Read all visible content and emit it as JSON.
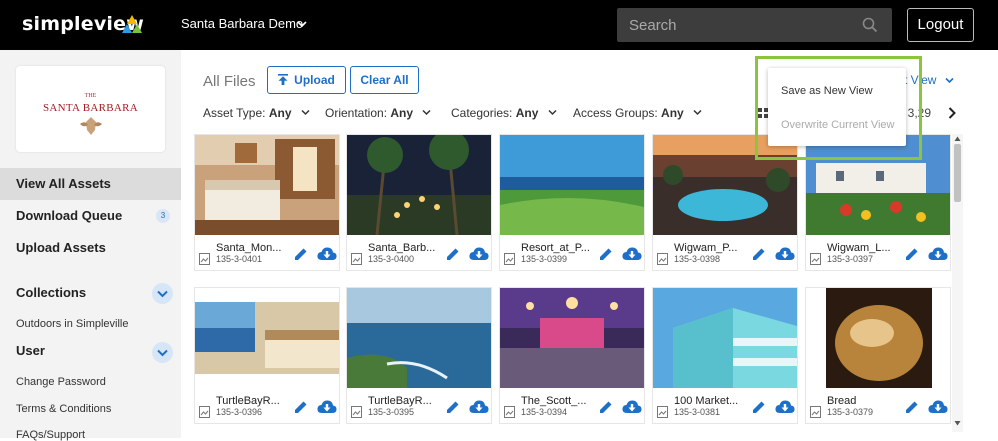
{
  "topbar": {
    "logo": "simpleview",
    "site": "Santa Barbara Demo",
    "search_placeholder": "Search",
    "logout": "Logout"
  },
  "brand": {
    "top_line": "THE",
    "name": "SANTA BARBARA"
  },
  "sidebar": {
    "items": [
      {
        "label": "View All Assets"
      },
      {
        "label": "Download Queue",
        "badge": "3"
      },
      {
        "label": "Upload Assets"
      }
    ],
    "collections_title": "Collections",
    "collections": [
      "Outdoors in Simpleville"
    ],
    "user_title": "User",
    "user_links": [
      "Change Password",
      "Terms & Conditions",
      "FAQs/Support"
    ]
  },
  "toolbar": {
    "title": "All Files",
    "upload": "Upload",
    "clear_all": "Clear All",
    "view_label": "t View",
    "page_text": "/ 3,29"
  },
  "filters": [
    {
      "label": "Asset Type:",
      "value": "Any"
    },
    {
      "label": "Orientation:",
      "value": "Any"
    },
    {
      "label": "Categories:",
      "value": "Any"
    },
    {
      "label": "Access Groups:",
      "value": "Any"
    }
  ],
  "dropdown": {
    "save_new": "Save as New View",
    "overwrite": "Overwrite Current View"
  },
  "assets": [
    {
      "name": "Santa_Mon...",
      "id": "135-3-0401"
    },
    {
      "name": "Santa_Barb...",
      "id": "135-3-0400"
    },
    {
      "name": "Resort_at_P...",
      "id": "135-3-0399"
    },
    {
      "name": "Wigwam_P...",
      "id": "135-3-0398"
    },
    {
      "name": "Wigwam_L...",
      "id": "135-3-0397"
    },
    {
      "name": "TurtleBayR...",
      "id": "135-3-0396"
    },
    {
      "name": "TurtleBayR...",
      "id": "135-3-0395"
    },
    {
      "name": "The_Scott_...",
      "id": "135-3-0394"
    },
    {
      "name": "100 Market...",
      "id": "135-3-0381"
    },
    {
      "name": "Bread",
      "id": "135-3-0379"
    }
  ],
  "colors": {
    "accent": "#1e6fc8",
    "highlight": "#8bc43f",
    "topbar": "#000000"
  }
}
